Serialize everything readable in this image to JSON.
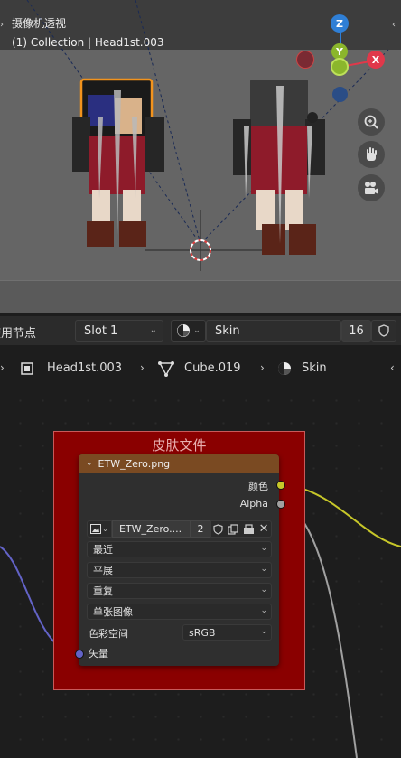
{
  "viewport": {
    "title": "摄像机透视",
    "subtitle": "(1) Collection | Head1st.003",
    "gizmo": {
      "z_label": "Z",
      "y_label": "Y",
      "x_label": "X"
    },
    "tools": [
      "zoom-icon",
      "hand-pan-icon",
      "camera-icon"
    ]
  },
  "header": {
    "use_nodes_label": "使用节点",
    "slot": "Slot 1",
    "material": "Skin",
    "user_count": "16"
  },
  "breadcrumb": {
    "object": "Head1st.003",
    "mesh": "Cube.019",
    "material": "Skin"
  },
  "node_editor": {
    "frame_label": "皮肤文件",
    "node_title": "ETW_Zero.png",
    "outputs": {
      "color": "颜色",
      "alpha": "Alpha"
    },
    "image_name": "ETW_Zero....",
    "image_users": "2",
    "interpolation": "最近",
    "projection": "平展",
    "extension": "重复",
    "source": "单张图像",
    "color_space_label": "色彩空间",
    "color_space": "sRGB",
    "input_vector": "矢量"
  },
  "colors": {
    "frame": "#8a0000",
    "node_header": "#7a4a22",
    "socket_color": "#c7c729",
    "socket_alpha": "#a1a1a1",
    "socket_vector": "#6363c7",
    "gizmo_x": "#e0384a",
    "gizmo_y": "#8bb62c",
    "gizmo_z": "#2f7fd6"
  }
}
